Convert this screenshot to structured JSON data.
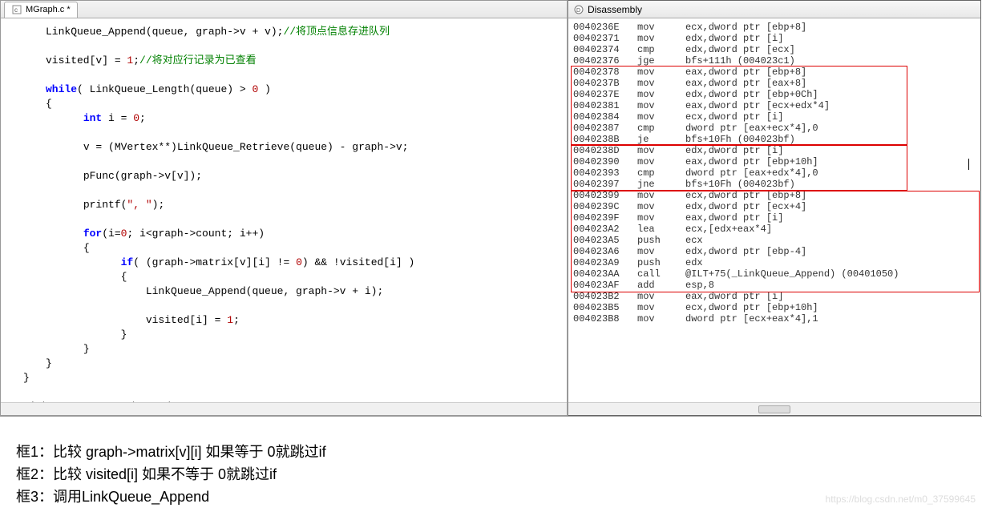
{
  "tab": {
    "file_name": "MGraph.c *"
  },
  "code": {
    "l1a": "LinkQueue_Append(queue, graph->v + v);",
    "l1b": "//将顶点信息存进队列",
    "l2a": "visited[v] = ",
    "l2b": "1",
    "l2c": ";",
    "l2d": "//将对应行记录为已查看",
    "l3a": "while",
    "l3b": "( LinkQueue_Length(queue) > ",
    "l3c": "0",
    "l3d": " )",
    "l4": "{",
    "l5a": "int",
    "l5b": " i = ",
    "l5c": "0",
    "l5d": ";",
    "l6": "v = (MVertex**)LinkQueue_Retrieve(queue) - graph->v;",
    "l7": "pFunc(graph->v[v]);",
    "l8a": "printf(",
    "l8b": "\", \"",
    "l8c": ");",
    "l9a": "for",
    "l9b": "(i=",
    "l9c": "0",
    "l9d": "; i<graph->count; i++)",
    "l10": "{",
    "l11a": "if",
    "l11b": "( (graph->matrix[v][i] != ",
    "l11c": "0",
    "l11d": ") && !visited[i] )",
    "l12": "{",
    "l13": "LinkQueue_Append(queue, graph->v + i);",
    "l14a": "visited[i] = ",
    "l14b": "1",
    "l14c": ";",
    "l15": "}",
    "l16": "}",
    "l17": "}",
    "l18": "}",
    "l19": "LinkQueue_Destroy(queue);"
  },
  "disasm": {
    "title": "Disassembly",
    "lines": [
      {
        "addr": "0040236E",
        "instr": "mov",
        "ops": "ecx,dword ptr [ebp+8]"
      },
      {
        "addr": "00402371",
        "instr": "mov",
        "ops": "edx,dword ptr [i]"
      },
      {
        "addr": "00402374",
        "instr": "cmp",
        "ops": "edx,dword ptr [ecx]"
      },
      {
        "addr": "00402376",
        "instr": "jge",
        "ops": "bfs+111h (004023c1)"
      },
      {
        "addr": "00402378",
        "instr": "mov",
        "ops": "eax,dword ptr [ebp+8]"
      },
      {
        "addr": "0040237B",
        "instr": "mov",
        "ops": "eax,dword ptr [eax+8]"
      },
      {
        "addr": "0040237E",
        "instr": "mov",
        "ops": "edx,dword ptr [ebp+0Ch]"
      },
      {
        "addr": "00402381",
        "instr": "mov",
        "ops": "eax,dword ptr [ecx+edx*4]"
      },
      {
        "addr": "00402384",
        "instr": "mov",
        "ops": "ecx,dword ptr [i]"
      },
      {
        "addr": "00402387",
        "instr": "cmp",
        "ops": "dword ptr [eax+ecx*4],0"
      },
      {
        "addr": "0040238B",
        "instr": "je",
        "ops": "bfs+10Fh (004023bf)"
      },
      {
        "addr": "0040238D",
        "instr": "mov",
        "ops": "edx,dword ptr [i]"
      },
      {
        "addr": "00402390",
        "instr": "mov",
        "ops": "eax,dword ptr [ebp+10h]"
      },
      {
        "addr": "00402393",
        "instr": "cmp",
        "ops": "dword ptr [eax+edx*4],0"
      },
      {
        "addr": "00402397",
        "instr": "jne",
        "ops": "bfs+10Fh (004023bf)"
      },
      {
        "addr": "00402399",
        "instr": "mov",
        "ops": "ecx,dword ptr [ebp+8]"
      },
      {
        "addr": "0040239C",
        "instr": "mov",
        "ops": "edx,dword ptr [ecx+4]"
      },
      {
        "addr": "0040239F",
        "instr": "mov",
        "ops": "eax,dword ptr [i]"
      },
      {
        "addr": "004023A2",
        "instr": "lea",
        "ops": "ecx,[edx+eax*4]"
      },
      {
        "addr": "004023A5",
        "instr": "push",
        "ops": "ecx"
      },
      {
        "addr": "004023A6",
        "instr": "mov",
        "ops": "edx,dword ptr [ebp-4]"
      },
      {
        "addr": "004023A9",
        "instr": "push",
        "ops": "edx"
      },
      {
        "addr": "004023AA",
        "instr": "call",
        "ops": "@ILT+75(_LinkQueue_Append) (00401050)"
      },
      {
        "addr": "004023AF",
        "instr": "add",
        "ops": "esp,8"
      },
      {
        "addr": "004023B2",
        "instr": "mov",
        "ops": "eax,dword ptr [i]"
      },
      {
        "addr": "004023B5",
        "instr": "mov",
        "ops": "ecx,dword ptr [ebp+10h]"
      },
      {
        "addr": "004023B8",
        "instr": "mov",
        "ops": "dword ptr [ecx+eax*4],1"
      }
    ]
  },
  "annotations": {
    "line1": "框1：比较 graph->matrix[v][i] 如果等于 0就跳过if",
    "line2": "框2：比较 visited[i] 如果不等于 0就跳过if",
    "line3": "框3：调用LinkQueue_Append"
  },
  "watermark": "https://blog.csdn.net/m0_37599645"
}
